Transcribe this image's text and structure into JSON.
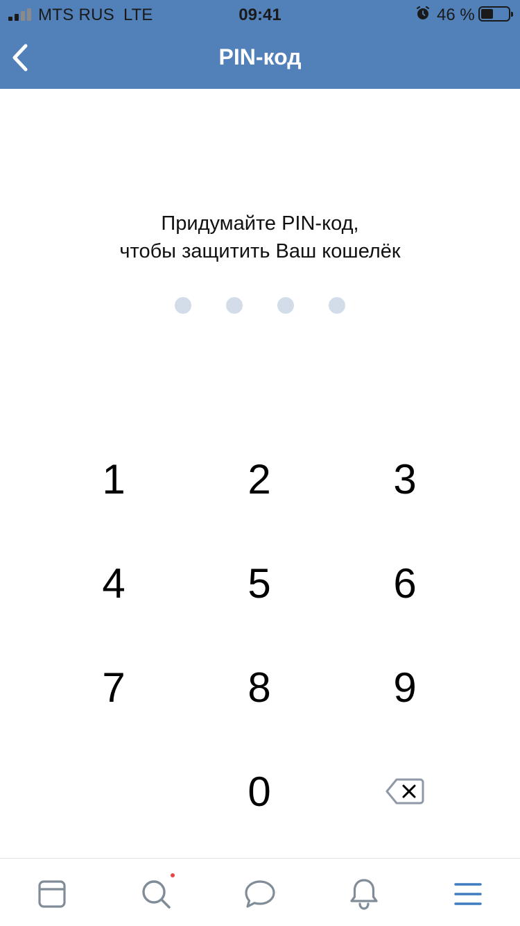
{
  "status_bar": {
    "carrier": "MTS RUS",
    "network": "LTE",
    "time": "09:41",
    "battery_percent": "46 %",
    "battery_level": 0.46,
    "signal_bars_active": 2,
    "signal_bars_total": 4
  },
  "nav": {
    "title": "PIN-код",
    "back_icon": "chevron-left-icon"
  },
  "prompt": {
    "line1": "Придумайте PIN-код,",
    "line2": "чтобы защитить Ваш кошелёк"
  },
  "pin": {
    "length": 4,
    "filled": 0,
    "dot_color": "#d2dde9"
  },
  "keypad": {
    "keys": [
      "1",
      "2",
      "3",
      "4",
      "5",
      "6",
      "7",
      "8",
      "9",
      "0"
    ],
    "backspace_icon": "backspace-icon"
  },
  "tab_bar": {
    "items": [
      {
        "icon": "news-icon"
      },
      {
        "icon": "search-icon",
        "has_notification": true
      },
      {
        "icon": "messages-icon"
      },
      {
        "icon": "notifications-bell-icon"
      },
      {
        "icon": "menu-icon",
        "active": true
      }
    ]
  },
  "colors": {
    "header_bg": "#5181b8",
    "active_tab": "#3f7dc1",
    "inactive_tab": "#818c99",
    "notification": "#e64646"
  }
}
